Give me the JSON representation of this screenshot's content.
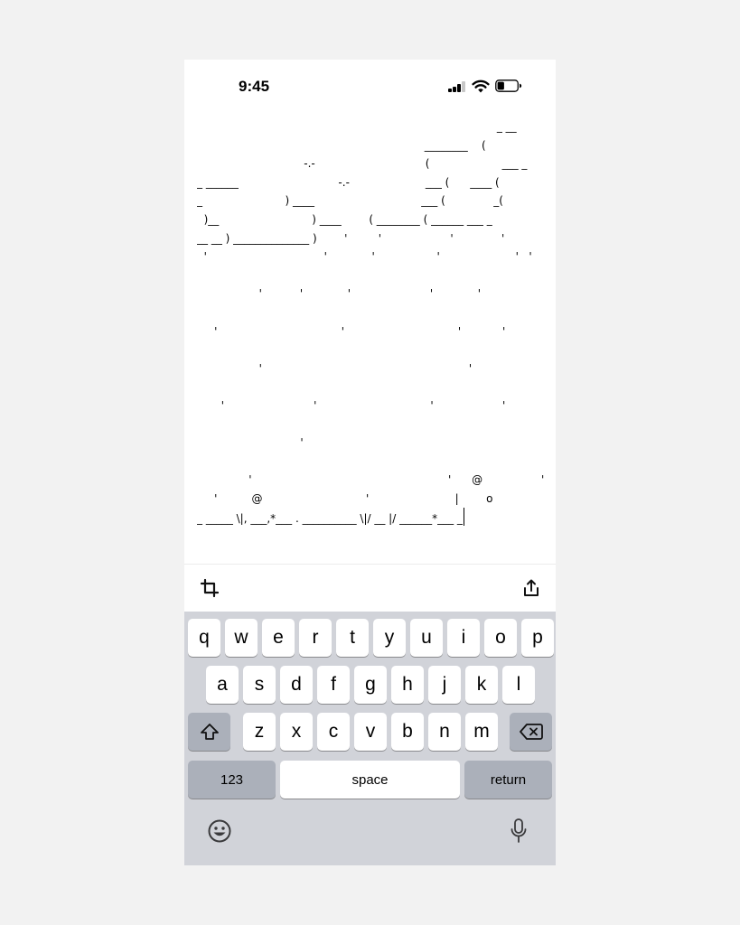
{
  "status_bar": {
    "time": "9:45",
    "signal_icon": "cellular-signal-icon",
    "wifi_icon": "wifi-icon",
    "battery_icon": "battery-icon",
    "battery_level": 0.35
  },
  "editor": {
    "ascii_lines": [
      "                                                                                       _ __",
      "                                                                  ________    (",
      "                               -.-                                (                     ___ _",
      "_ ______                             -.-                      ___ (      ____ (",
      "_                        ) ____                               ___ (              _(",
      "  )__                           ) ____        ( ________ ( ______ ___ _",
      "__ __ ) ______________ )        '         '                    '              '",
      "  '                                  '             '                  '                      '   '",
      "",
      "                  '           '             '                       '             '                             '",
      "",
      "     '                                    '                                 '            '                     '",
      "",
      "                  '                                                            '",
      "",
      "       '                          '                                 '                    '",
      "",
      "                              '                                                                           '",
      "",
      "               '                                                         '      @                 '",
      "     '          @                              '                         |        o",
      "_ _____ \\|, ___,*___ . __________ \\|/ __ |/ ______*___ _"
    ]
  },
  "toolbar": {
    "crop_icon": "crop-icon",
    "share_icon": "share-icon"
  },
  "keyboard": {
    "row1": [
      "q",
      "w",
      "e",
      "r",
      "t",
      "y",
      "u",
      "i",
      "o",
      "p"
    ],
    "row2": [
      "a",
      "s",
      "d",
      "f",
      "g",
      "h",
      "j",
      "k",
      "l"
    ],
    "row3": [
      "z",
      "x",
      "c",
      "v",
      "b",
      "n",
      "m"
    ],
    "shift_icon": "shift-icon",
    "delete_icon": "delete-backspace-icon",
    "numbers_label": "123",
    "space_label": "space",
    "return_label": "return",
    "emoji_icon": "emoji-icon",
    "mic_icon": "microphone-icon",
    "key_text_color": "#000000",
    "keyboard_bg": "#d1d3d9",
    "dark_key_bg": "#abb0ba"
  }
}
